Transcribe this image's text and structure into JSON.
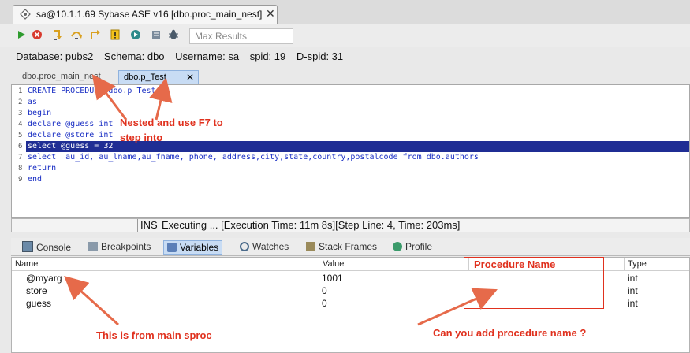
{
  "window_tab": {
    "title": "sa@10.1.1.69 Sybase ASE v16 [dbo.proc_main_nest]",
    "close": "✕"
  },
  "toolbar": {
    "max_results_placeholder": "Max Results"
  },
  "info": {
    "database": "Database:  pubs2",
    "schema": "Schema:  dbo",
    "username": "Username:  sa",
    "spid": "spid:  19",
    "dspid": "D-spid:  31"
  },
  "editor_tabs": [
    {
      "label": "dbo.proc_main_nest"
    },
    {
      "label": "dbo.p_Test",
      "close": "✕"
    }
  ],
  "code_lines": [
    {
      "n": "1",
      "text": "CREATE PROCEDURE dbo.p_Test"
    },
    {
      "n": "2",
      "text": "as"
    },
    {
      "n": "3",
      "text": "begin"
    },
    {
      "n": "4",
      "text": "declare @guess int"
    },
    {
      "n": "5",
      "text": "declare @store int"
    },
    {
      "n": "6",
      "text": "select @guess = 32"
    },
    {
      "n": "7",
      "text": "select  au_id, au_lname,au_fname, phone, address,city,state,country,postalcode from dbo.authors"
    },
    {
      "n": "8",
      "text": "return"
    },
    {
      "n": "9",
      "text": "end"
    }
  ],
  "status": {
    "mode": "INS",
    "message": "Executing ... [Execution Time: 11m 8s][Step Line: 4, Time: 203ms]"
  },
  "panel_tabs": [
    "Console",
    "Breakpoints",
    "Variables",
    "Watches",
    "Stack Frames",
    "Profile"
  ],
  "variables": {
    "headers": [
      "Name",
      "Value",
      "",
      "Type"
    ],
    "rows": [
      {
        "name": "@myarg",
        "value": "1001",
        "type": "int"
      },
      {
        "name": "store",
        "value": "0",
        "type": "int"
      },
      {
        "name": "guess",
        "value": "0",
        "type": "int"
      }
    ]
  },
  "annotations": {
    "nested": "Nested and use F7 to\nstep into",
    "procedure_name": "Procedure Name",
    "main_sproc": "This is from main sproc",
    "add_name": "Can you add procedure name ?"
  },
  "colors": {
    "annotation": "#e0311e",
    "selection": "#1f2d94",
    "active_tab": "#c8dcf4"
  }
}
